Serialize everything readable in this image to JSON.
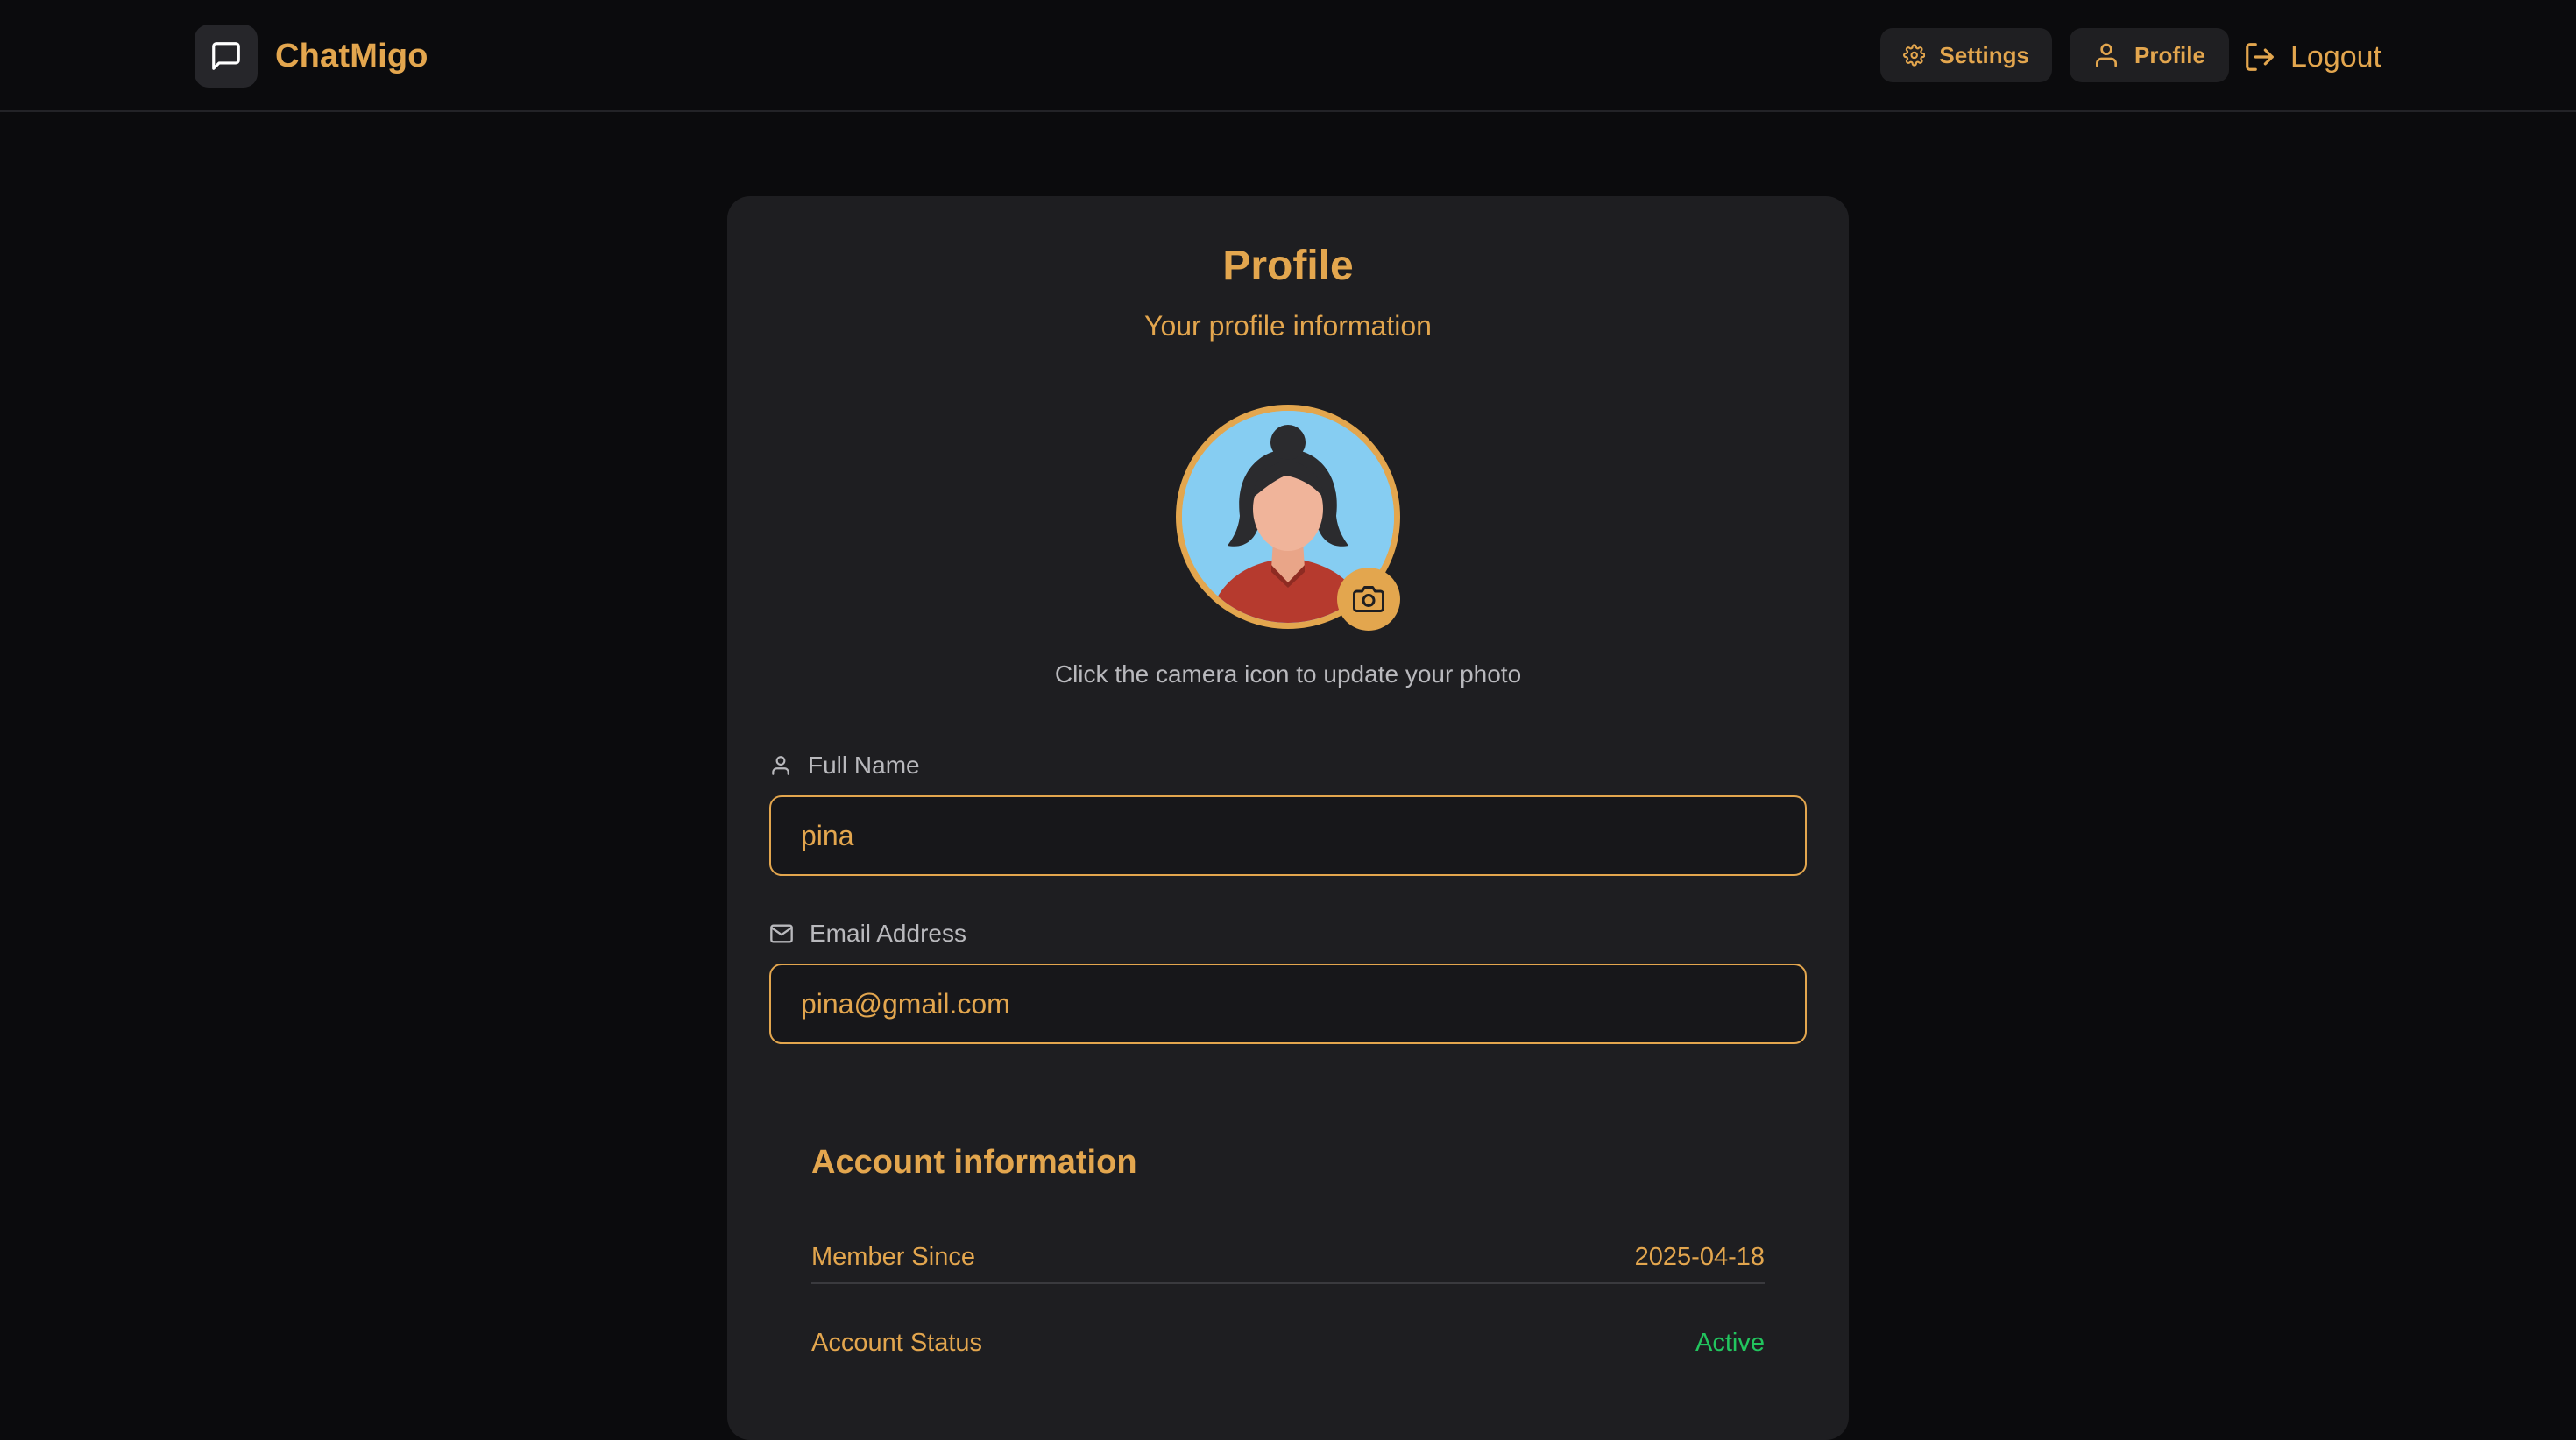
{
  "header": {
    "brand_name": "ChatMigo",
    "nav": {
      "settings_label": "Settings",
      "profile_label": "Profile",
      "logout_label": "Logout"
    },
    "icons": {
      "brand": "message-square-icon",
      "settings": "gear-icon",
      "profile": "user-icon",
      "logout": "logout-icon"
    }
  },
  "profile": {
    "title": "Profile",
    "subtitle": "Your profile information",
    "photo_hint": "Click the camera icon to update your photo",
    "fields": {
      "full_name": {
        "label": "Full Name",
        "value": "pina"
      },
      "email": {
        "label": "Email Address",
        "value": "pina@gmail.com"
      }
    }
  },
  "account_info": {
    "title": "Account information",
    "member_since_label": "Member Since",
    "member_since_value": "2025-04-18",
    "status_label": "Account Status",
    "status_value": "Active"
  },
  "colors": {
    "accent": "#e3a64e",
    "background": "#0b0b0d",
    "card": "#1e1e21",
    "status_active": "#22c55e"
  }
}
